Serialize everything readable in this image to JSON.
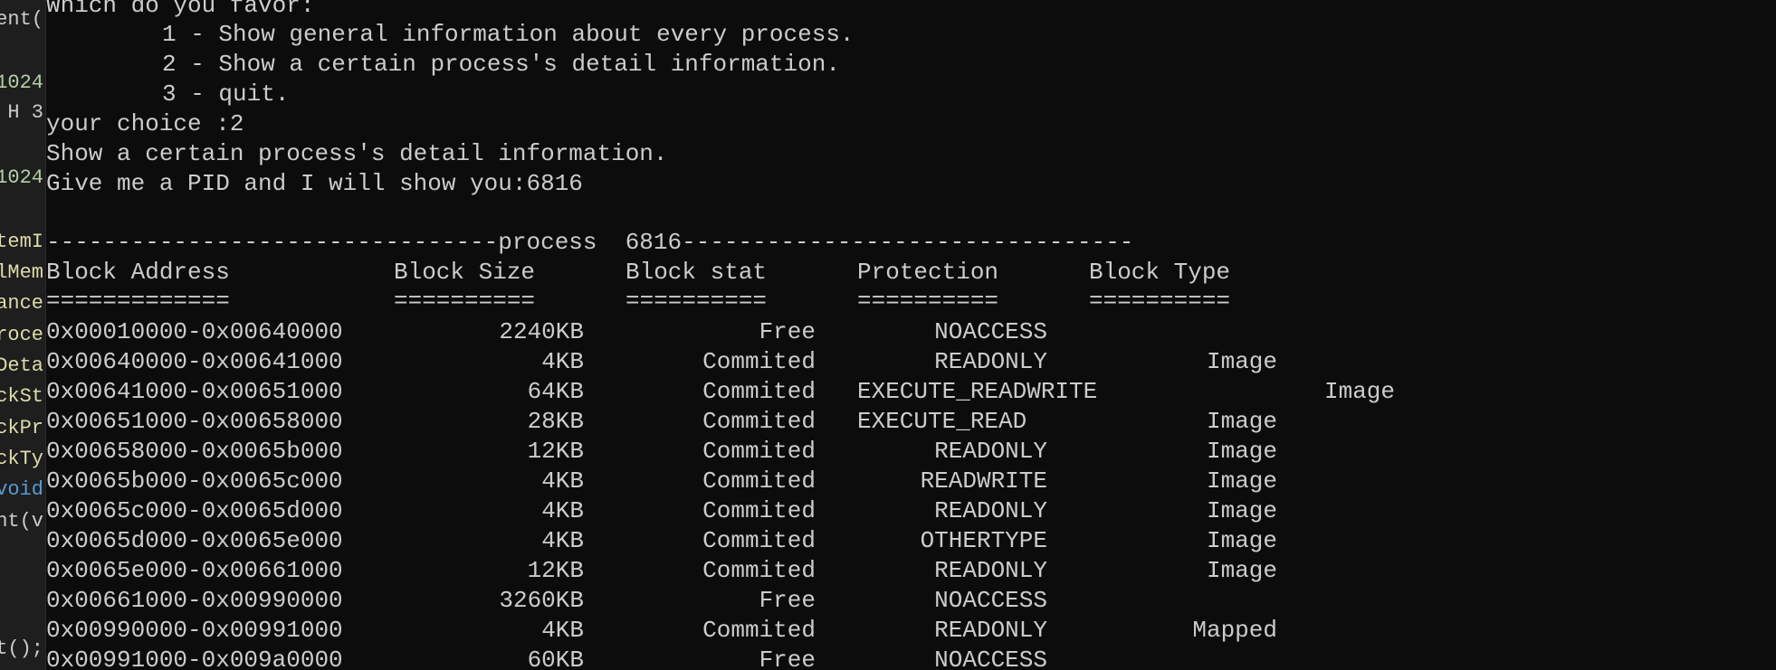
{
  "gutter": {
    "lines": [
      {
        "text": "ent(",
        "color": "#cccccc"
      },
      {
        "text": "1024",
        "color": "#b5cea8"
      },
      {
        "text": "H 3",
        "color": "#cccccc"
      },
      {
        "text": "1024",
        "color": "#b5cea8"
      },
      {
        "text": "temI",
        "color": "#dcdcaa"
      },
      {
        "text": "lMem",
        "color": "#dcdcaa"
      },
      {
        "text": "ance",
        "color": "#dcdcaa"
      },
      {
        "text": "roce",
        "color": "#dcdcaa"
      },
      {
        "text": "Deta",
        "color": "#dcdcaa"
      },
      {
        "text": "ckSt",
        "color": "#dcdcaa"
      },
      {
        "text": "ckPr",
        "color": "#dcdcaa"
      },
      {
        "text": "ckTy",
        "color": "#dcdcaa"
      },
      {
        "text": "void",
        "color": "#569cd6"
      },
      {
        "text": "nt(v",
        "color": "#cccccc"
      },
      {
        "text": "t();",
        "color": "#cccccc"
      }
    ]
  },
  "console": {
    "menu_prompt": "Which do you favor:",
    "menu_options": [
      "1 - Show general information about every process.",
      "2 - Show a certain process's detail information.",
      "3 - quit."
    ],
    "choice_line": "your choice :2",
    "mode_line": "Show a certain process's detail information.",
    "pid_line": "Give me a PID and I will show you:6816",
    "separator_line": "--------------------------------process  6816--------------------------------",
    "headers": [
      "Block Address",
      "Block Size",
      "Block stat",
      "Protection",
      "Block Type"
    ],
    "header_underlines": [
      "=============",
      "==========",
      "==========",
      "==========",
      "=========="
    ],
    "rows": [
      {
        "address": "0x00010000-0x00640000",
        "size": "2240KB",
        "stat": "Free",
        "protection": "NOACCESS",
        "type": "",
        "type_shifted": false
      },
      {
        "address": "0x00640000-0x00641000",
        "size": "4KB",
        "stat": "Commited",
        "protection": "READONLY",
        "type": "Image",
        "type_shifted": false
      },
      {
        "address": "0x00641000-0x00651000",
        "size": "64KB",
        "stat": "Commited",
        "protection": "EXECUTE_READWRITE",
        "type": "Image",
        "type_shifted": true
      },
      {
        "address": "0x00651000-0x00658000",
        "size": "28KB",
        "stat": "Commited",
        "protection": "EXECUTE_READ",
        "type": "Image",
        "type_shifted": false
      },
      {
        "address": "0x00658000-0x0065b000",
        "size": "12KB",
        "stat": "Commited",
        "protection": "READONLY",
        "type": "Image",
        "type_shifted": false
      },
      {
        "address": "0x0065b000-0x0065c000",
        "size": "4KB",
        "stat": "Commited",
        "protection": "READWRITE",
        "type": "Image",
        "type_shifted": false
      },
      {
        "address": "0x0065c000-0x0065d000",
        "size": "4KB",
        "stat": "Commited",
        "protection": "READONLY",
        "type": "Image",
        "type_shifted": false
      },
      {
        "address": "0x0065d000-0x0065e000",
        "size": "4KB",
        "stat": "Commited",
        "protection": "OTHERTYPE",
        "type": "Image",
        "type_shifted": false
      },
      {
        "address": "0x0065e000-0x00661000",
        "size": "12KB",
        "stat": "Commited",
        "protection": "READONLY",
        "type": "Image",
        "type_shifted": false
      },
      {
        "address": "0x00661000-0x00990000",
        "size": "3260KB",
        "stat": "Free",
        "protection": "NOACCESS",
        "type": "",
        "type_shifted": false
      },
      {
        "address": "0x00990000-0x00991000",
        "size": "4KB",
        "stat": "Commited",
        "protection": "READONLY",
        "type": "Mapped",
        "type_shifted": false
      },
      {
        "address": "0x00991000-0x009a0000",
        "size": "60KB",
        "stat": "Free",
        "protection": "NOACCESS",
        "type": "",
        "type_shifted": false
      }
    ]
  },
  "colors": {
    "background": "#0c0c0c",
    "text": "#cccccc",
    "gutter_background": "#1e1e1e"
  }
}
